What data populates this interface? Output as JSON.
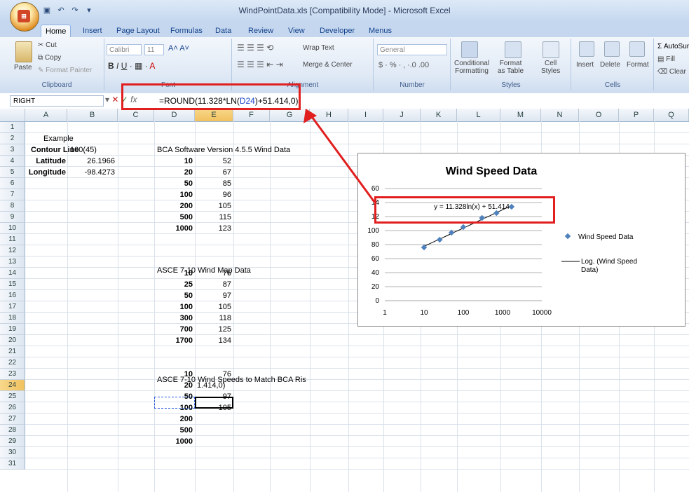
{
  "window": {
    "title": "WindPointData.xls  [Compatibility Mode] - Microsoft Excel"
  },
  "tabs": [
    "Home",
    "Insert",
    "Page Layout",
    "Formulas",
    "Data",
    "Review",
    "View",
    "Developer",
    "Menus"
  ],
  "ribbon": {
    "clipboard": {
      "paste": "Paste",
      "cut": "Cut",
      "copy": "Copy",
      "format_painter": "Format Painter",
      "label": "Clipboard"
    },
    "font": {
      "name": "Calibri",
      "size": "11",
      "label": "Font"
    },
    "alignment": {
      "wrap": "Wrap Text",
      "merge": "Merge & Center",
      "label": "Alignment"
    },
    "number": {
      "format": "General",
      "currency": "$",
      "percent": "%",
      "label": "Number"
    },
    "styles": {
      "conditional": "Conditional",
      "conditional2": "Formatting",
      "format_table": "Format",
      "format_table2": "as Table",
      "cell_styles": "Cell",
      "cell_styles2": "Styles",
      "label": "Styles"
    },
    "cells": {
      "insert": "Insert",
      "delete": "Delete",
      "format": "Format",
      "label": "Cells"
    },
    "editing": {
      "autosum": "AutoSum",
      "fill": "Fill",
      "clear": "Clear"
    }
  },
  "formula_bar": {
    "name_box": "RIGHT",
    "fx": "fx",
    "formula_before": "=ROUND(11.328*LN(",
    "formula_ref": "D24",
    "formula_after": ")+51.414,0)"
  },
  "columns": [
    "A",
    "B",
    "C",
    "D",
    "E",
    "F",
    "G",
    "H",
    "I",
    "J",
    "K",
    "L",
    "M",
    "N",
    "O",
    "P",
    "Q"
  ],
  "rows": [
    "1",
    "2",
    "3",
    "4",
    "5",
    "6",
    "7",
    "8",
    "9",
    "10",
    "11",
    "12",
    "13",
    "14",
    "15",
    "16",
    "17",
    "18",
    "19",
    "20",
    "21",
    "22",
    "23",
    "24",
    "25",
    "26",
    "27",
    "28",
    "29",
    "30",
    "31"
  ],
  "sheet": {
    "example": "Example",
    "contour_label": "Contour Line",
    "contour_value": "100(45)",
    "lat_label": "Latitude",
    "lat_value": "26.1966",
    "lon_label": "Longitude",
    "lon_value": "-98.4273",
    "bca_title": "BCA Software Version 4.5.5 Wind Data",
    "bca": [
      [
        "10",
        "52"
      ],
      [
        "20",
        "67"
      ],
      [
        "50",
        "85"
      ],
      [
        "100",
        "96"
      ],
      [
        "200",
        "105"
      ],
      [
        "500",
        "115"
      ],
      [
        "1000",
        "123"
      ]
    ],
    "asce_title": "ASCE 7-10 Wind Map Data",
    "asce": [
      [
        "10",
        "76"
      ],
      [
        "25",
        "87"
      ],
      [
        "50",
        "97"
      ],
      [
        "100",
        "105"
      ],
      [
        "300",
        "118"
      ],
      [
        "700",
        "125"
      ],
      [
        "1700",
        "134"
      ]
    ],
    "match_title": "ASCE 7-10 Wind Speeds to Match BCA Ris",
    "match": [
      [
        "10",
        "76"
      ],
      [
        "20",
        "1.414,0)"
      ],
      [
        "50",
        "97"
      ],
      [
        "100",
        "105"
      ],
      [
        "200",
        ""
      ],
      [
        "500",
        ""
      ],
      [
        "1000",
        ""
      ]
    ]
  },
  "chart_data": {
    "type": "scatter",
    "title": "Wind Speed Data",
    "x_scale": "log",
    "xlim": [
      1,
      10000
    ],
    "ylim": [
      0,
      160
    ],
    "x_ticks": [
      "1",
      "10",
      "100",
      "1000",
      "10000"
    ],
    "y_ticks": [
      "0",
      "20",
      "40",
      "60",
      "80",
      "100",
      "120",
      "140",
      "160"
    ],
    "y_ticks_visible": [
      "0",
      "20",
      "40",
      "60",
      "80",
      "100",
      "12",
      "14",
      "60"
    ],
    "grid": true,
    "legend_position": "right",
    "series": [
      {
        "name": "Wind Speed Data",
        "x": [
          10,
          25,
          50,
          100,
          300,
          700,
          1700
        ],
        "y": [
          76,
          87,
          97,
          105,
          118,
          125,
          134
        ]
      }
    ],
    "trendline": {
      "name": "Log. (Wind Speed Data)",
      "a": 11.328,
      "b": 51.414
    },
    "equation": "y = 11.328ln(x) + 51.414"
  },
  "colors": {
    "annotation": "#e11f1f",
    "marker": "#4f81bd"
  }
}
